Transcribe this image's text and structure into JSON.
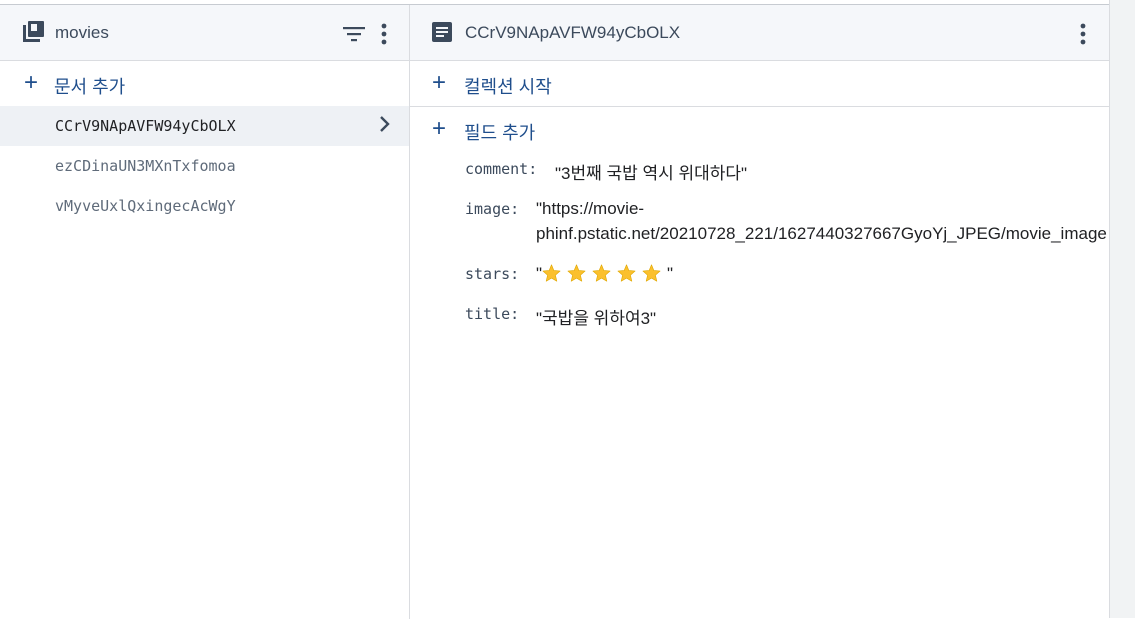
{
  "collection_panel": {
    "title": "movies",
    "add_document_label": "문서 추가",
    "documents": [
      {
        "id": "CCrV9NApAVFW94yCbOLX",
        "selected": true
      },
      {
        "id": "ezCDinaUN3MXnTxfomoa",
        "selected": false
      },
      {
        "id": "vMyveUxlQxingecAcWgY",
        "selected": false
      }
    ]
  },
  "document_panel": {
    "title": "CCrV9NApAVFW94yCbOLX",
    "start_collection_label": "컬렉션 시작",
    "add_field_label": "필드 추가",
    "fields": [
      {
        "key": "comment:",
        "value": "\"3번째 국밥 역시 위대하다\""
      },
      {
        "key": "image:",
        "value_line1": "\"https://movie-",
        "value_line2": "phinf.pstatic.net/20210728_221/1627440327667GyoYj_JPEG/movie_image"
      },
      {
        "key": "stars:",
        "value_open": "\"",
        "value_close": "\"",
        "star_count": 5
      },
      {
        "key": "title:",
        "value": "\"국밥을 위하여3\""
      }
    ]
  },
  "colors": {
    "accent": "#1f4e8c",
    "header_bg": "#f5f7fa",
    "selected_bg": "#eef1f5",
    "star": "#fbc02d"
  }
}
